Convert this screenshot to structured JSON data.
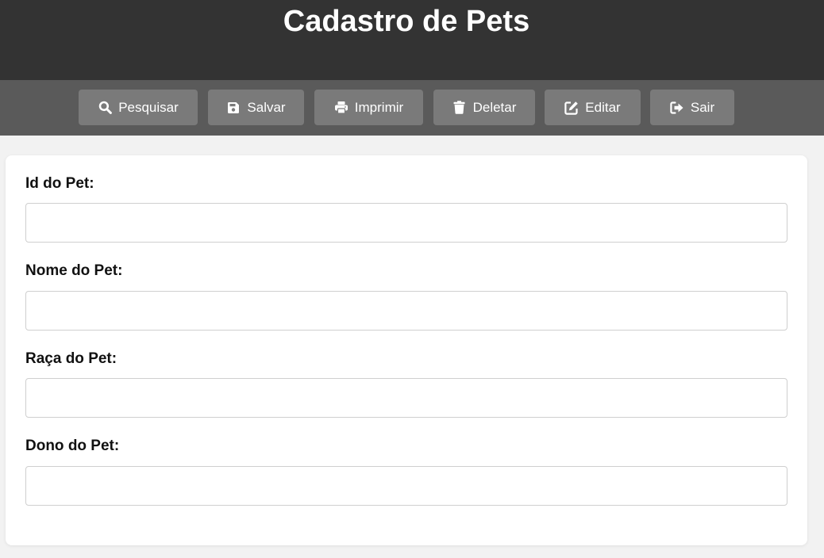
{
  "header": {
    "title": "Cadastro de Pets"
  },
  "toolbar": {
    "buttons": [
      {
        "label": "Pesquisar",
        "icon": "search-icon"
      },
      {
        "label": "Salvar",
        "icon": "save-icon"
      },
      {
        "label": "Imprimir",
        "icon": "print-icon"
      },
      {
        "label": "Deletar",
        "icon": "trash-icon"
      },
      {
        "label": "Editar",
        "icon": "edit-icon"
      },
      {
        "label": "Sair",
        "icon": "sign-out-icon"
      }
    ]
  },
  "form": {
    "fields": [
      {
        "label": "Id do Pet:",
        "value": "",
        "placeholder": ""
      },
      {
        "label": "Nome do Pet:",
        "value": "",
        "placeholder": ""
      },
      {
        "label": "Raça do Pet:",
        "value": "",
        "placeholder": ""
      },
      {
        "label": "Dono do Pet:",
        "value": "",
        "placeholder": ""
      }
    ]
  },
  "colors": {
    "header_bg": "#333333",
    "toolbar_bg": "#5a5a5a",
    "button_bg": "#7a7a7a",
    "page_bg": "#f2f2f2"
  }
}
